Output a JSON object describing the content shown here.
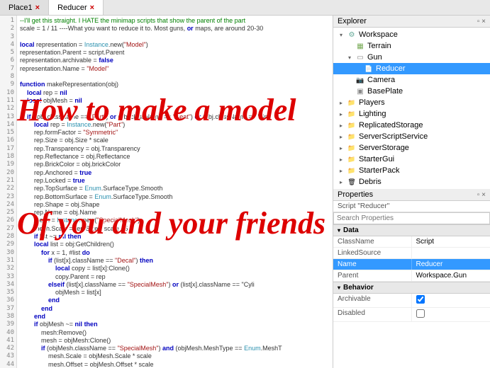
{
  "tabs": [
    {
      "label": "Place1",
      "closable": true
    },
    {
      "label": "Reducer",
      "closable": true
    }
  ],
  "close_icon": "×",
  "code": {
    "lines": [
      {
        "n": 1,
        "c": "comment",
        "t": "--I'll get this straight. I HATE the minimap scripts that show the parent of the part"
      },
      {
        "n": 2,
        "c": "",
        "t": "scale = 1 / 11 ----What you want to reduce it to. Most guns, or maps, are around 20-30"
      },
      {
        "n": 3,
        "c": "",
        "t": ""
      },
      {
        "n": 4,
        "c": "",
        "t": "local representation = Instance.new(\"Model\")"
      },
      {
        "n": 5,
        "c": "",
        "t": "representation.Parent = script.Parent"
      },
      {
        "n": 6,
        "c": "",
        "t": "representation.archivable = false"
      },
      {
        "n": 7,
        "c": "",
        "t": "representation.Name = \"Model\""
      },
      {
        "n": 8,
        "c": "",
        "t": ""
      },
      {
        "n": 9,
        "c": "keyword",
        "t": "function makeRepresentation(obj)"
      },
      {
        "n": 10,
        "c": "",
        "t": "    local rep = nil"
      },
      {
        "n": 11,
        "c": "",
        "t": "    local objMesh = nil"
      },
      {
        "n": 12,
        "c": "",
        "t": ""
      },
      {
        "n": 13,
        "c": "",
        "t": "    if ((obj.className == \"Part\") or (obj.className == \"Seat\") or (obj.className == \"Sp"
      },
      {
        "n": 14,
        "c": "",
        "t": "        local rep = Instance.new(\"Part\")"
      },
      {
        "n": 15,
        "c": "",
        "t": "        rep.formFactor = \"Symmetric\""
      },
      {
        "n": 16,
        "c": "",
        "t": "        rep.Size = obj.Size * scale"
      },
      {
        "n": 17,
        "c": "",
        "t": "        rep.Transparency = obj.Transparency"
      },
      {
        "n": 18,
        "c": "",
        "t": "        rep.Reflectance = obj.Reflectance"
      },
      {
        "n": 19,
        "c": "",
        "t": "        rep.BrickColor = obj.brickColor"
      },
      {
        "n": 20,
        "c": "",
        "t": "        rep.Anchored = true"
      },
      {
        "n": 21,
        "c": "",
        "t": "        rep.Locked = true"
      },
      {
        "n": 22,
        "c": "",
        "t": "        rep.TopSurface = Enum.SurfaceType.Smooth"
      },
      {
        "n": 23,
        "c": "",
        "t": "        rep.BottomSurface = Enum.SurfaceType.Smooth"
      },
      {
        "n": 24,
        "c": "",
        "t": "        rep.Shape = obj.Shape"
      },
      {
        "n": 25,
        "c": "",
        "t": "        rep.Name = obj.Name"
      },
      {
        "n": 26,
        "c": "",
        "t": "        mesh = Instance.new(\"SpecialMesh\")"
      },
      {
        "n": 27,
        "c": "",
        "t": "        mesh.Scale = rep.Size * scale / 5"
      },
      {
        "n": 28,
        "c": "",
        "t": "        if list ~= nil then"
      },
      {
        "n": 29,
        "c": "",
        "t": "        local list = obj:GetChildren()"
      },
      {
        "n": 30,
        "c": "",
        "t": "            for x = 1, #list do"
      },
      {
        "n": 31,
        "c": "",
        "t": "                if (list[x].className == \"Decal\") then"
      },
      {
        "n": 32,
        "c": "",
        "t": "                    local copy = list[x]:Clone()"
      },
      {
        "n": 33,
        "c": "",
        "t": "                    copy.Parent = rep"
      },
      {
        "n": 34,
        "c": "",
        "t": "                elseif (list[x].className == \"SpecialMesh\") or (list[x].className == \"Cyli"
      },
      {
        "n": 35,
        "c": "",
        "t": "                    objMesh = list[x]"
      },
      {
        "n": 36,
        "c": "",
        "t": "                end"
      },
      {
        "n": 37,
        "c": "",
        "t": "            end"
      },
      {
        "n": 38,
        "c": "",
        "t": "        end"
      },
      {
        "n": 39,
        "c": "",
        "t": "        if objMesh ~= nil then"
      },
      {
        "n": 40,
        "c": "",
        "t": "            mesh:Remove()"
      },
      {
        "n": 41,
        "c": "",
        "t": "            mesh = objMesh:Clone()"
      },
      {
        "n": 42,
        "c": "",
        "t": "            if (objMesh.className == \"SpecialMesh\") and (objMesh.MeshType == Enum.MeshT"
      },
      {
        "n": 43,
        "c": "",
        "t": "                mesh.Scale = objMesh.Scale * scale"
      },
      {
        "n": 44,
        "c": "",
        "t": "                mesh.Offset = objMesh.Offset * scale"
      }
    ]
  },
  "explorer": {
    "title": "Explorer",
    "items": [
      {
        "name": "Workspace",
        "icon": "ic-ws",
        "indent": 0,
        "tw": "▾"
      },
      {
        "name": "Terrain",
        "icon": "ic-terr",
        "indent": 1,
        "tw": ""
      },
      {
        "name": "Gun",
        "icon": "ic-mdl",
        "indent": 1,
        "tw": "▾"
      },
      {
        "name": "Reducer",
        "icon": "ic-scr",
        "indent": 2,
        "tw": "",
        "sel": true
      },
      {
        "name": "Camera",
        "icon": "ic-cam",
        "indent": 1,
        "tw": ""
      },
      {
        "name": "BasePlate",
        "icon": "ic-part",
        "indent": 1,
        "tw": ""
      },
      {
        "name": "Players",
        "icon": "ic-folder",
        "indent": 0,
        "tw": "▸"
      },
      {
        "name": "Lighting",
        "icon": "ic-folder",
        "indent": 0,
        "tw": "▸"
      },
      {
        "name": "ReplicatedStorage",
        "icon": "ic-folder",
        "indent": 0,
        "tw": "▸"
      },
      {
        "name": "ServerScriptService",
        "icon": "ic-folder",
        "indent": 0,
        "tw": "▸"
      },
      {
        "name": "ServerStorage",
        "icon": "ic-folder",
        "indent": 0,
        "tw": "▸"
      },
      {
        "name": "StarterGui",
        "icon": "ic-folder",
        "indent": 0,
        "tw": "▸"
      },
      {
        "name": "StarterPack",
        "icon": "ic-folder",
        "indent": 0,
        "tw": "▸"
      },
      {
        "name": "Debris",
        "icon": "ic-debris",
        "indent": 0,
        "tw": "▸"
      }
    ]
  },
  "properties": {
    "title": "Properties",
    "subtitle": "Script \"Reducer\"",
    "search_placeholder": "Search Properties",
    "categories": [
      {
        "name": "Data",
        "rows": [
          {
            "name": "ClassName",
            "value": "Script",
            "sel": false
          },
          {
            "name": "LinkedSource",
            "value": "",
            "sel": false
          },
          {
            "name": "Name",
            "value": "Reducer",
            "sel": true
          },
          {
            "name": "Parent",
            "value": "Workspace.Gun",
            "sel": false
          }
        ]
      },
      {
        "name": "Behavior",
        "rows": [
          {
            "name": "Archivable",
            "value": "checkbox-checked",
            "sel": false
          },
          {
            "name": "Disabled",
            "value": "checkbox-unchecked",
            "sel": false
          }
        ]
      }
    ]
  },
  "overlay": {
    "line1": "How to make a model",
    "line2": "Of you and your friends"
  }
}
